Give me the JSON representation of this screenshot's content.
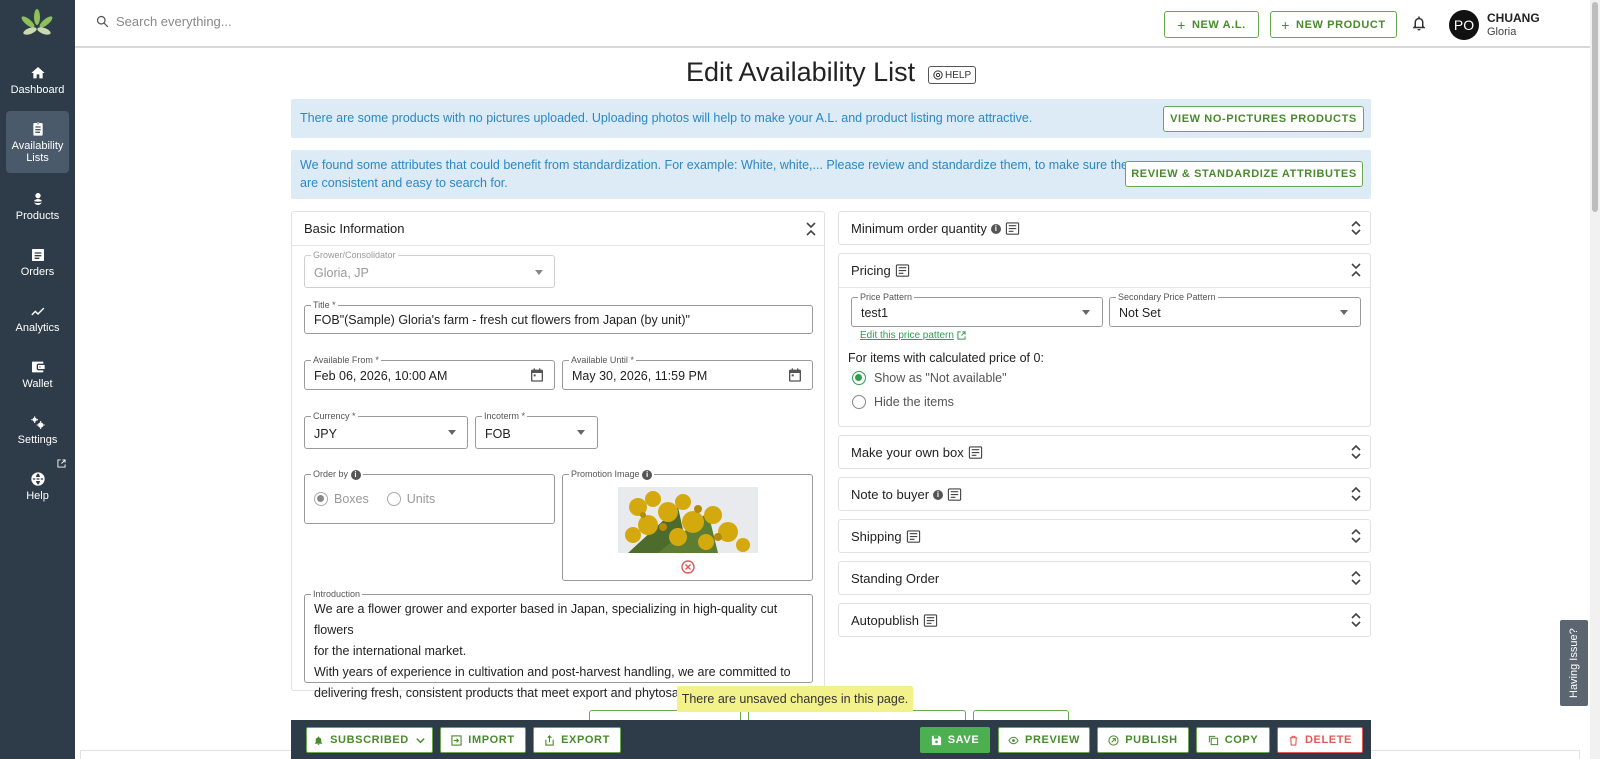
{
  "sidebar": {
    "items": [
      {
        "label": "Dashboard",
        "icon": "home-icon"
      },
      {
        "label": "Availability Lists",
        "icon": "clipboard-icon"
      },
      {
        "label": "Products",
        "icon": "flower-icon"
      },
      {
        "label": "Orders",
        "icon": "list-icon"
      },
      {
        "label": "Analytics",
        "icon": "trend-icon"
      },
      {
        "label": "Wallet",
        "icon": "wallet-icon"
      },
      {
        "label": "Settings",
        "icon": "gear-icon"
      },
      {
        "label": "Help",
        "icon": "globe-icon"
      }
    ]
  },
  "topbar": {
    "search_placeholder": "Search everything...",
    "new_al": "NEW A.L.",
    "new_product": "NEW PRODUCT",
    "avatar": "PO",
    "user_name": "CHUANG",
    "user_sub": "Gloria"
  },
  "page": {
    "title": "Edit Availability List",
    "help": "HELP"
  },
  "banners": {
    "pictures_text": "There are some products with no pictures uploaded. Uploading photos will help to make your A.L. and product listing more attractive.",
    "pictures_button": "VIEW NO-PICTURES PRODUCTS",
    "attributes_text_1": "We found some attributes that could benefit from standardization. For example: White, white,... Please review and standardize them, to make sure they",
    "attributes_text_2": "are consistent and easy to search for.",
    "attributes_button": "REVIEW & STANDARDIZE ATTRIBUTES"
  },
  "basic": {
    "header": "Basic Information",
    "grower_label": "Grower/Consolidator",
    "grower_value": "Gloria, JP",
    "title_label": "Title *",
    "title_value": "FOB\"(Sample) Gloria's farm - fresh cut flowers from Japan (by unit)\"",
    "from_label": "Available From *",
    "from_value": "Feb 06, 2026, 10:00 AM",
    "until_label": "Available Until *",
    "until_value": "May 30, 2026, 11:59 PM",
    "currency_label": "Currency *",
    "currency_value": "JPY",
    "incoterm_label": "Incoterm *",
    "incoterm_value": "FOB",
    "order_by_label": "Order by",
    "order_by_boxes": "Boxes",
    "order_by_units": "Units",
    "promo_label": "Promotion Image",
    "intro_label": "Introduction",
    "intro_lines": [
      "We are a flower grower and exporter based in Japan, specializing in high-quality cut flowers",
      "for the international market.",
      "With years of experience in cultivation and post-harvest handling, we are committed to",
      "delivering fresh, consistent products that meet export and phytosanitary standards."
    ]
  },
  "right": {
    "moq": "Minimum order quantity",
    "pricing": "Pricing",
    "price_pattern_label": "Price Pattern",
    "price_pattern_value": "test1",
    "secondary_label": "Secondary Price Pattern",
    "secondary_value": "Not Set",
    "edit_link": "Edit this price pattern",
    "zero_label": "For items with calculated price of 0:",
    "show_na": "Show as \"Not available\"",
    "hide_items": "Hide the items",
    "own_box": "Make your own box",
    "note_buyer": "Note to buyer",
    "shipping": "Shipping",
    "standing": "Standing Order",
    "autopublish": "Autopublish"
  },
  "toast": "There are unsaved changes in this page.",
  "bottom": {
    "subscribed": "SUBSCRIBED",
    "import": "IMPORT",
    "export": "EXPORT",
    "save": "SAVE",
    "preview": "PREVIEW",
    "publish": "PUBLISH",
    "copy": "COPY",
    "delete": "DELETE"
  },
  "having_issue": "Having Issue?",
  "colors": {
    "sidebar": "#2e3b48",
    "accent_green": "#4caf50",
    "banner_bg": "#dcebf6",
    "banner_text": "#2b87c5",
    "delete_red": "#e05a5a"
  }
}
